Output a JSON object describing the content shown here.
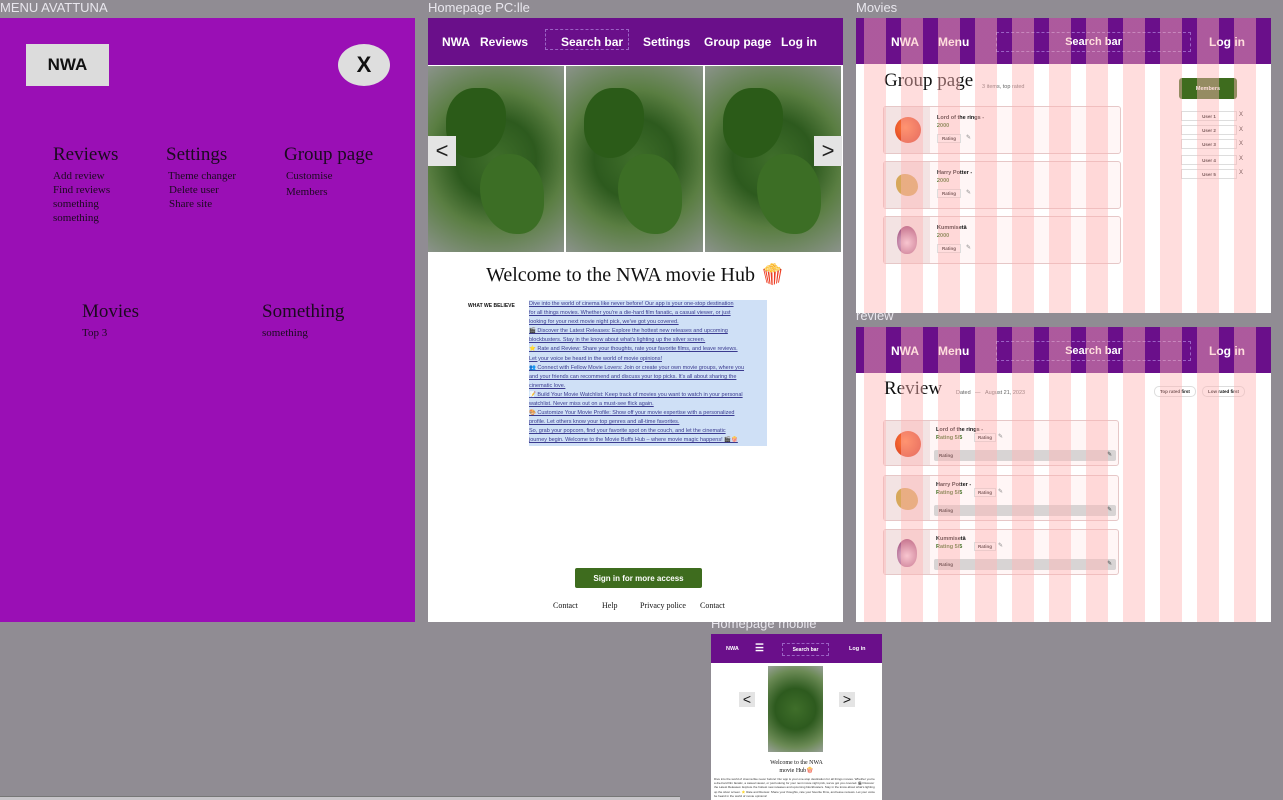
{
  "frames": {
    "menu_label": "MENU AVATTUNA",
    "home_label": "Homepage PC:lle",
    "movies_label": "Movies",
    "review_label": "review",
    "mobile_label": "Homepage mobile"
  },
  "menu": {
    "logo": "NWA",
    "close": "X",
    "columns": [
      {
        "title": "Reviews",
        "items": [
          "Add review",
          "Find reviews",
          "something",
          "something"
        ]
      },
      {
        "title": "Settings",
        "items": [
          "Theme changer",
          "Delete user",
          "Share site"
        ]
      },
      {
        "title": "Group page",
        "items": [
          "Customise",
          "Members"
        ]
      },
      {
        "title": "Movies",
        "items": [
          "Top 3"
        ]
      },
      {
        "title": "Something",
        "items": [
          "something"
        ]
      }
    ]
  },
  "home": {
    "nav": {
      "logo": "NWA",
      "reviews": "Reviews",
      "search": "Search bar",
      "settings": "Settings",
      "group": "Group page",
      "login": "Log in"
    },
    "prev": "<",
    "next": ">",
    "welcome": "Welcome to the NWA movie Hub 🍿",
    "believe": "WHAT WE BELIEVE",
    "paragraphs": [
      "Dive into the world of cinema like never before! Our app is your one-stop destination",
      "for all things movies. Whether you're a die-hard film fanatic, a casual viewer, or just",
      "looking for your next movie night pick, we've got you covered.",
      "🎬 Discover the Latest Releases: Explore the hottest new releases and upcoming",
      "blockbusters. Stay in the know about what's lighting up the silver screen.",
      "⭐ Rate and Review: Share your thoughts, rate your favorite films, and leave reviews.",
      "Let your voice be heard in the world of movie opinions!",
      "👥 Connect with Fellow Movie Lovers: Join or create your own movie groups, where you",
      "and your friends can recommend and discuss your top picks. It's all about sharing the",
      "cinematic love.",
      "📝 Build Your Movie Watchlist: Keep track of movies you want to watch in your personal",
      "watchlist. Never miss out on a must-see flick again.",
      "🎨 Customize Your Movie Profile: Show off your movie expertise with a personalized",
      "profile. Let others know your top genres and all-time favorites.",
      "So, grab your popcorn, find your favorite spot on the couch, and let the cinematic",
      "journey begin. Welcome to the Movie Buffs Hub – where movie magic happens! 🎬🍿"
    ],
    "signin": "Sign in for more access",
    "footer": [
      "Contact",
      "Help",
      "Privacy police",
      "Contact"
    ]
  },
  "movies": {
    "nav": {
      "logo": "NWA",
      "menu": "Menu",
      "search": "Search bar",
      "login": "Log in"
    },
    "title": "Group page",
    "subtitle": "3 items, top rated",
    "members_button": "Members",
    "users": [
      "User 1",
      "User 2",
      "User 3",
      "User 4",
      "User 5"
    ],
    "user_remove": "X",
    "cards": [
      {
        "name": "Lord of the rings -",
        "year": "2000",
        "rating": "Rating",
        "image": "tomato"
      },
      {
        "name": "Harry Potter -",
        "year": "2000",
        "rating": "Rating",
        "image": "ginger"
      },
      {
        "name": "Kummisetä",
        "year": "2000",
        "rating": "Rating",
        "image": "onion"
      }
    ]
  },
  "review": {
    "nav": {
      "logo": "NWA",
      "menu": "Menu",
      "search": "Search bar",
      "login": "Log in"
    },
    "title": "Review",
    "dated": "Dated",
    "dash": "—",
    "date": "August 21, 2023",
    "sort_top": "Top rated first",
    "sort_low": "Low rated first",
    "cards": [
      {
        "name": "Lord of the rings -",
        "rating": "Rating 5/5",
        "pill": "Rating",
        "bar": "Rating",
        "image": "tomato"
      },
      {
        "name": "Harry Potter -",
        "rating": "Rating 5/5",
        "pill": "Rating",
        "bar": "Rating",
        "image": "ginger"
      },
      {
        "name": "Kummisetä",
        "rating": "Rating 5/5",
        "pill": "Rating",
        "bar": "Rating",
        "image": "onion"
      }
    ]
  },
  "mobile": {
    "nav": {
      "logo": "NWA",
      "menu_icon": "☰",
      "search": "Search bar",
      "login": "Log in"
    },
    "prev": "<",
    "next": ">",
    "welcome_line1": "Welcome to the NWA",
    "welcome_line2": "movie Hub🍿",
    "text": "Dive into the world of cinema like never before! Our app is your one-stop destination for all things movies. Whether you're a die-hard film fanatic, a casual viewer, or just looking for your next movie night pick, we've got you covered. 🎬 Discover the Latest Releases: Explore the hottest new releases and upcoming blockbusters. Stay in the know about what's lighting up the silver screen. ⭐ Rate and Review: Share your thoughts, rate your favorite films, and leave reviews. Let your voice be heard in the world of movie opinions!"
  },
  "colors": {
    "purple": "#9a0fb5",
    "nav_purple": "#6a0f8a",
    "green": "#3e6c1e",
    "canvas": "#908c93"
  }
}
